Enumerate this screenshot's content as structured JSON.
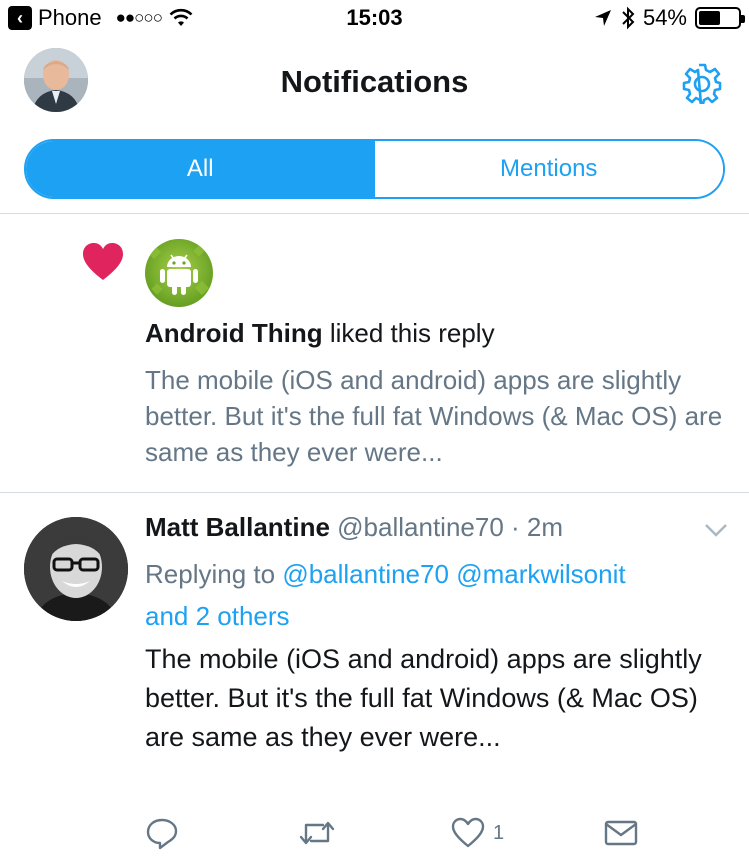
{
  "status_bar": {
    "carrier": "Phone",
    "signal": "●●○○○",
    "time": "15:03",
    "battery": "54%",
    "battery_fraction": 0.54
  },
  "header": {
    "title": "Notifications"
  },
  "tabs": [
    {
      "label": "All",
      "active": true
    },
    {
      "label": "Mentions",
      "active": false
    }
  ],
  "like_notification": {
    "actor": "Android Thing",
    "action": " liked this reply",
    "text": "The mobile (iOS and android) apps are slightly better. But it's the full fat Windows (& Mac OS) are same as they ever were..."
  },
  "tweet": {
    "name": "Matt Ballantine",
    "handle": "@ballantine70",
    "sep": " · ",
    "time": "2m",
    "replying_prefix": "Replying to ",
    "reply_to_1": "@ballantine70",
    "reply_to_2": "@markwilsonit",
    "reply_others": "and 2 others",
    "text": "The mobile (iOS and android) apps are slightly better. But it's the full fat Windows (& Mac OS) are same as they ever were...",
    "like_count": "1"
  },
  "colors": {
    "accent": "#1da1f2",
    "heart": "#e0245e",
    "secondary_text": "#657786",
    "divider": "#d6dbe0"
  },
  "icons": {
    "back": "chevron-left-icon",
    "wifi": "wifi-icon",
    "location": "location-arrow-icon",
    "bluetooth": "bluetooth-icon",
    "settings": "gear-icon",
    "like": "heart-icon",
    "reply": "reply-icon",
    "retweet": "retweet-icon",
    "dm": "envelope-icon",
    "more": "chevron-down-icon"
  }
}
